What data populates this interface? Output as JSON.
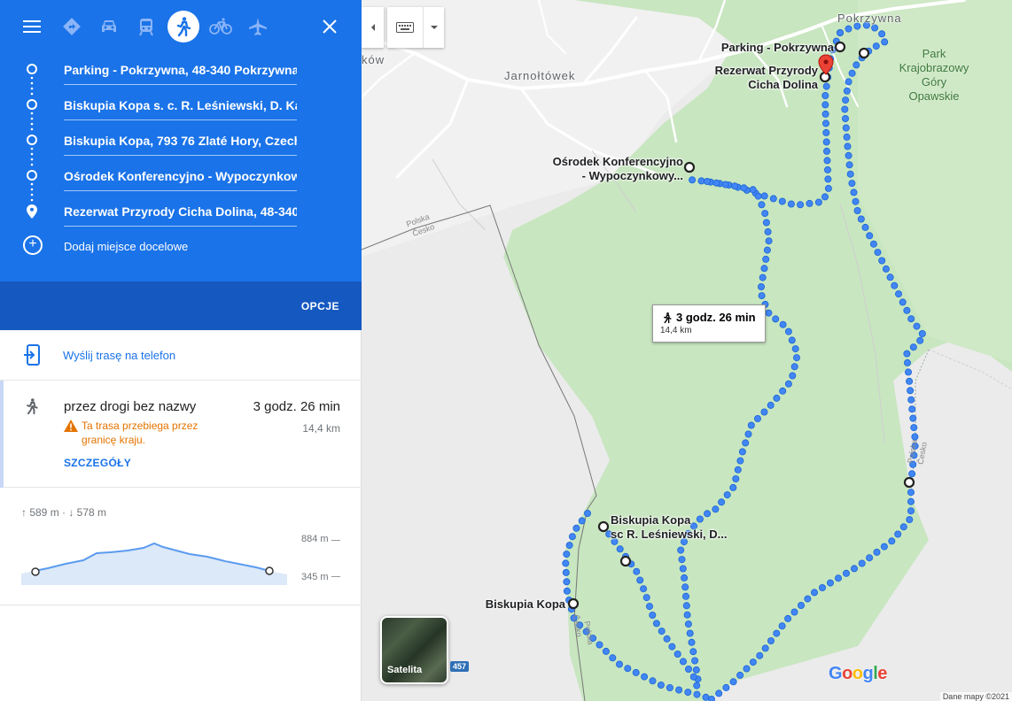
{
  "top_bar": {
    "menu_icon": "hamburger-menu-icon",
    "modes": [
      {
        "name": "best-route",
        "icon": "directions-diamond-icon"
      },
      {
        "name": "driving",
        "icon": "car-icon"
      },
      {
        "name": "transit",
        "icon": "train-icon"
      },
      {
        "name": "walking",
        "icon": "walking-person-icon",
        "selected": true
      },
      {
        "name": "cycling",
        "icon": "bicycle-icon"
      },
      {
        "name": "flights",
        "icon": "airplane-icon"
      }
    ],
    "close_icon": "close-icon"
  },
  "waypoints": [
    {
      "value": "Parking - Pokrzywna, 48-340 Pokrzywna"
    },
    {
      "value": "Biskupia Kopa s. c. R. Leśniewski, D. Ka"
    },
    {
      "value": "Biskupia Kopa, 793 76 Zlaté Hory, Czech"
    },
    {
      "value": "Ośrodek Konferencyjno - Wypoczynkowy"
    },
    {
      "value": "Rezerwat Przyrody Cicha Dolina, 48-340"
    }
  ],
  "add_destination_label": "Dodaj miejsce docelowe",
  "options_label": "OPCJE",
  "send_to_phone_label": "Wyślij trasę na telefon",
  "route": {
    "via": "przez drogi bez nazwy",
    "time": "3 godz. 26 min",
    "distance": "14,4 km",
    "warning": "Ta trasa przebiega przez granicę kraju.",
    "details_label": "SZCZEGÓŁY"
  },
  "elevation": {
    "stats": "↑ 589 m · ↓ 578 m",
    "max_label": "884 m",
    "min_label": "345 m"
  },
  "map": {
    "labels": {
      "pokrzywna": "Pokrzywna",
      "parking": "Parking - Pokrzywna",
      "rezerwat_1": "Rezerwat Przyrody",
      "rezerwat_2": "Cicha Dolina",
      "osrodek_1": "Ośrodek Konferencyjno",
      "osrodek_2": "- Wypoczynkowy...",
      "biskupia_sc_1": "Biskupia Kopa",
      "biskupia_sc_2": "sc R. Leśniewski, D...",
      "biskupia_kopa": "Biskupia Kopa",
      "jarnoltowek": "Jarnołtówek",
      "kow": "ków",
      "park_1": "Park",
      "park_2": "Krajobrazowy",
      "park_3": "Góry",
      "park_4": "Opawskie",
      "polska": "Polska",
      "cesko": "Česko"
    },
    "duration_box": {
      "time": "3 godz. 26 min",
      "distance": "14,4 km"
    },
    "satellite_label": "Satelita",
    "road_number": "457",
    "google_logo": "Google",
    "map_data_label": "Dane mapy ©2021"
  },
  "colors": {
    "header_blue": "#1a73e8",
    "options_blue": "#1558c0",
    "route_dot_blue": "#4285f4",
    "warning_orange": "#e37400",
    "forest_green": "#c8e6c0",
    "pin_red": "#ea4335"
  }
}
